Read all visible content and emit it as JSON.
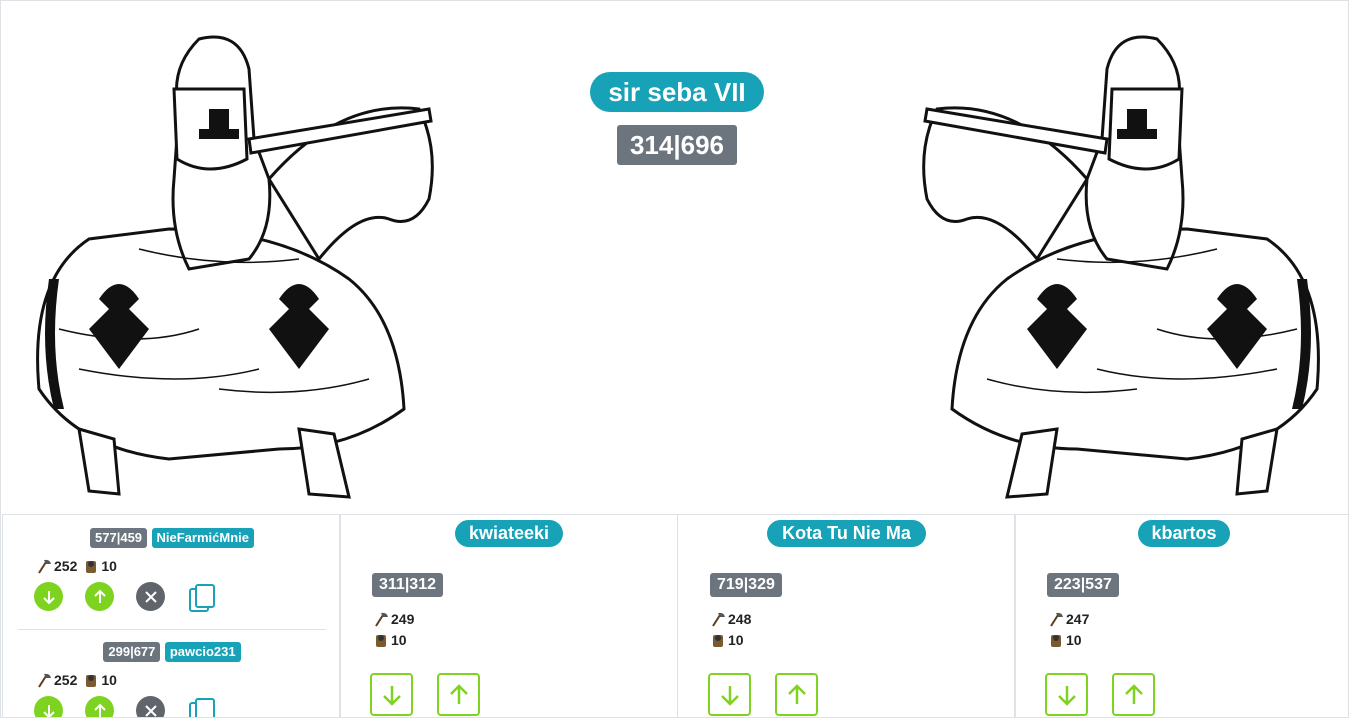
{
  "header": {
    "player_name": "sir seba VII",
    "village_coords": "314|696"
  },
  "knight_images": [
    "knight-on-horse-illustration",
    "knight-on-horse-illustration-mirrored"
  ],
  "colors": {
    "teal": "#17a2b8",
    "grey": "#6c757d",
    "green": "#7ed321",
    "dark_grey": "#5f656b"
  },
  "icons": {
    "axe": "axe-icon",
    "spy": "spy-icon",
    "arrow_down": "arrow-down-icon",
    "arrow_up": "arrow-up-icon",
    "close": "close-icon",
    "copy": "copy-icon"
  },
  "list_panel": {
    "entries": [
      {
        "coords": "577|459",
        "player": "NieFarmićMnie",
        "axe": "252",
        "spy": "10"
      },
      {
        "coords": "299|677",
        "player": "pawcio231",
        "axe": "252",
        "spy": "10"
      }
    ]
  },
  "targets": [
    {
      "name": "kwiateeki",
      "coords": "311|312",
      "axe": "249",
      "spy": "10"
    },
    {
      "name": "Kota Tu Nie Ma",
      "coords": "719|329",
      "axe": "248",
      "spy": "10"
    },
    {
      "name": "kbartos",
      "coords": "223|537",
      "axe": "247",
      "spy": "10"
    }
  ]
}
